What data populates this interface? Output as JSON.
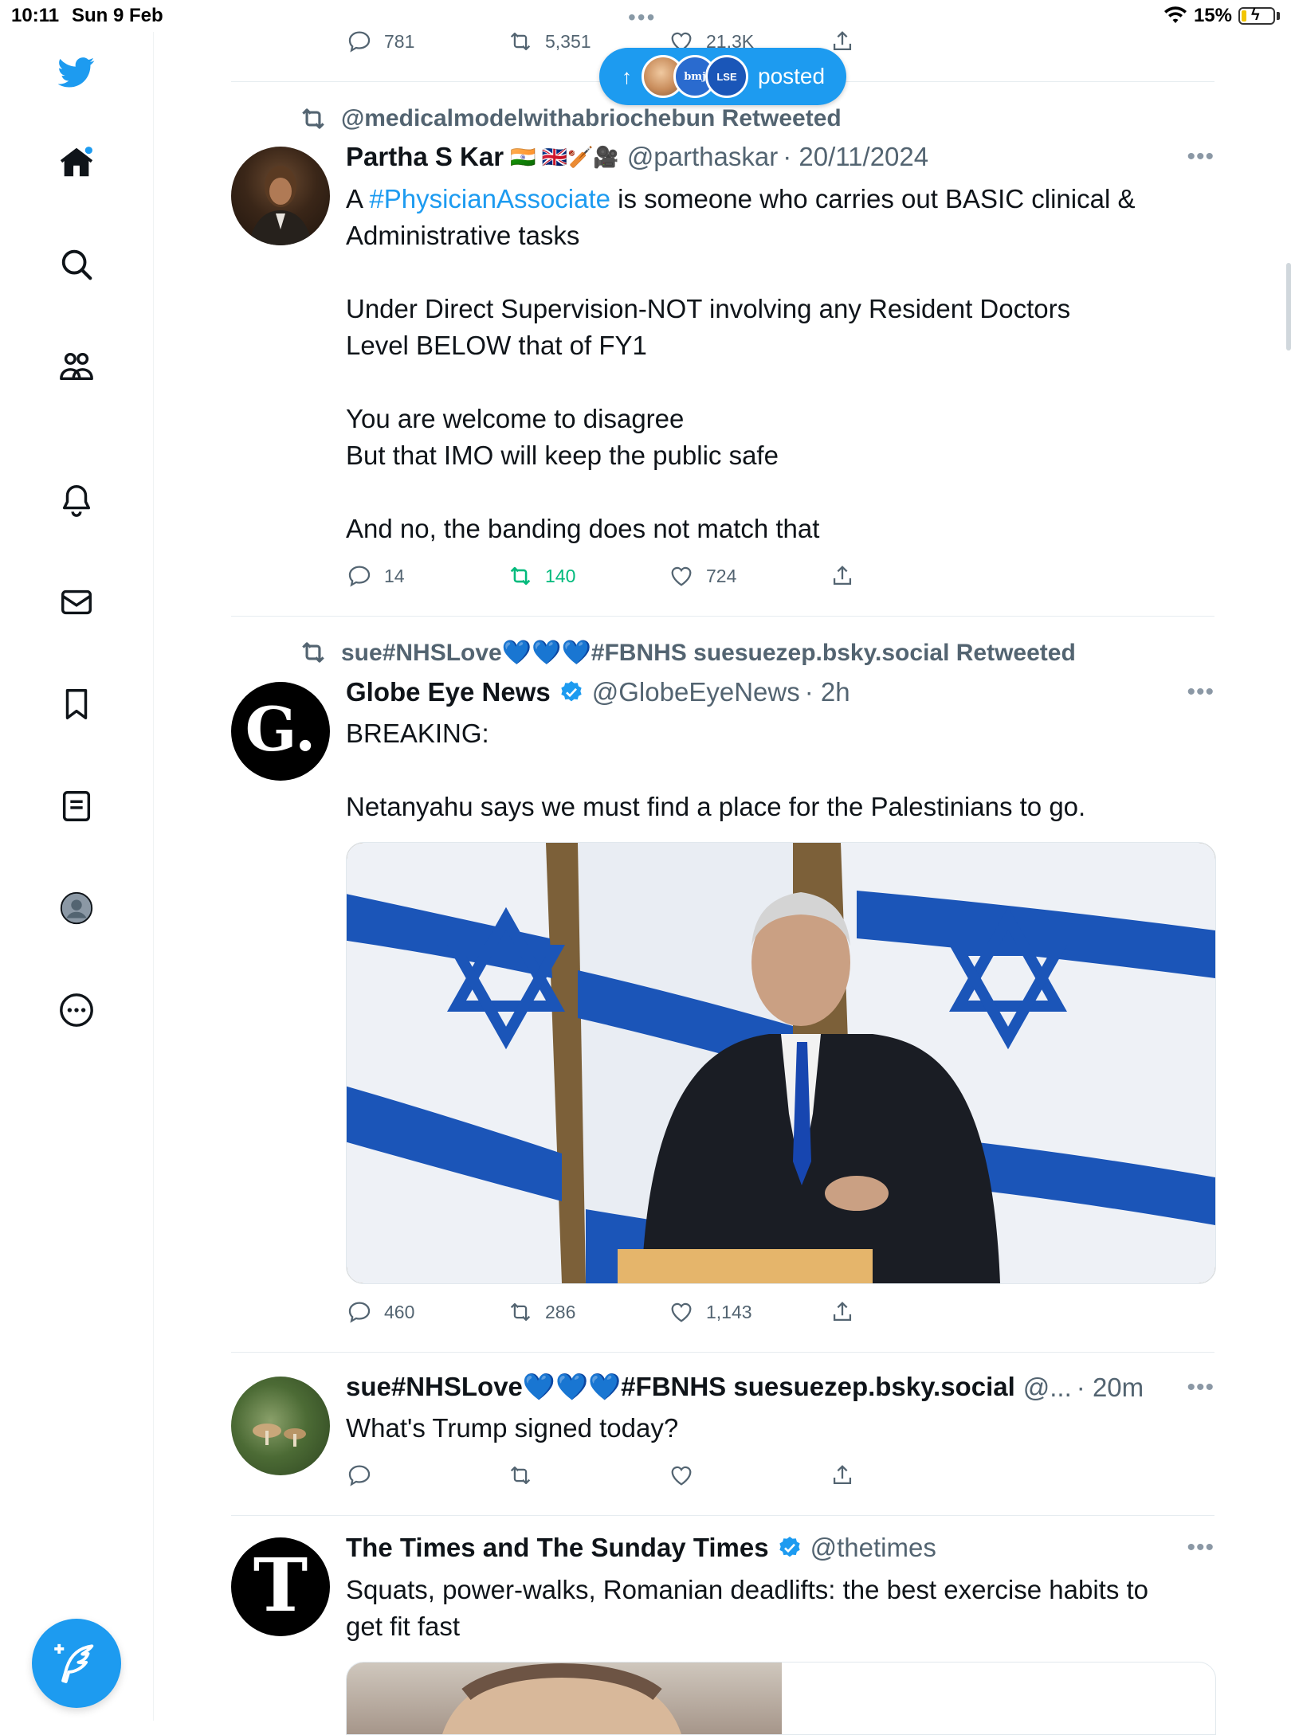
{
  "status_bar": {
    "time": "10:11",
    "date": "Sun 9 Feb",
    "battery": "15%",
    "top_dots": "•••"
  },
  "sidebar": {
    "items": [
      {
        "icon": "twitter-bird-icon"
      },
      {
        "icon": "home-icon"
      },
      {
        "icon": "search-icon"
      },
      {
        "icon": "communities-icon"
      },
      {
        "icon": "bell-icon"
      },
      {
        "icon": "mail-icon"
      },
      {
        "icon": "bookmark-icon"
      },
      {
        "icon": "lists-icon"
      },
      {
        "icon": "profile-icon"
      },
      {
        "icon": "more-icon"
      }
    ],
    "compose_icon": "compose-feather-icon"
  },
  "new_posts_pill": {
    "arrow": "↑",
    "av1": "",
    "av2": "bmj",
    "av3": "LSE",
    "label": "posted"
  },
  "colors": {
    "accent": "#1d9bf0",
    "retweet_green": "#00ba7c",
    "muted": "#536471"
  },
  "tweets": [
    {
      "partial_actions": {
        "replies": "781",
        "retweets": "5,351",
        "likes": "21.3K"
      }
    },
    {
      "retweeted_by": "@medicalmodelwithabriochebun Retweeted",
      "name": "Partha S Kar",
      "flags": "🇮🇳 🇬🇧🏏🎥",
      "handle": "@parthaskar",
      "time": "· 20/11/2024",
      "text_prefix": "A ",
      "hashtag": "#PhysicianAssociate",
      "text_main": " is someone who carries out BASIC clinical & Administrative tasks\n\nUnder Direct Supervision-NOT involving any Resident Doctors\nLevel BELOW that of FY1\n\nYou are welcome to disagree\nBut that IMO will keep the public safe\n\nAnd no, the banding does not match that",
      "replies": "14",
      "retweets": "140",
      "likes": "724"
    },
    {
      "retweeted_by": "sue#NHSLove💙💙💙#FBNHS suesuezep.bsky.social Retweeted",
      "name": "Globe Eye News",
      "handle": "@GlobeEyeNews",
      "time": "· 2h",
      "avatar_letter": "G.",
      "text": "BREAKING:\n\nNetanyahu says we must find a place for the Palestinians to go.",
      "replies": "460",
      "retweets": "286",
      "likes": "1,143"
    },
    {
      "name": "sue#NHSLove💙💙💙#FBNHS suesuezep.bsky.social",
      "handle": "@...",
      "time": "· 20m",
      "text": "What's Trump signed today?"
    },
    {
      "name": "The Times and The Sunday Times",
      "handle": "@thetimes",
      "avatar_letter": "T",
      "text": "Squats, power-walks, Romanian deadlifts: the best exercise habits to get fit fast"
    }
  ],
  "more": "•••"
}
